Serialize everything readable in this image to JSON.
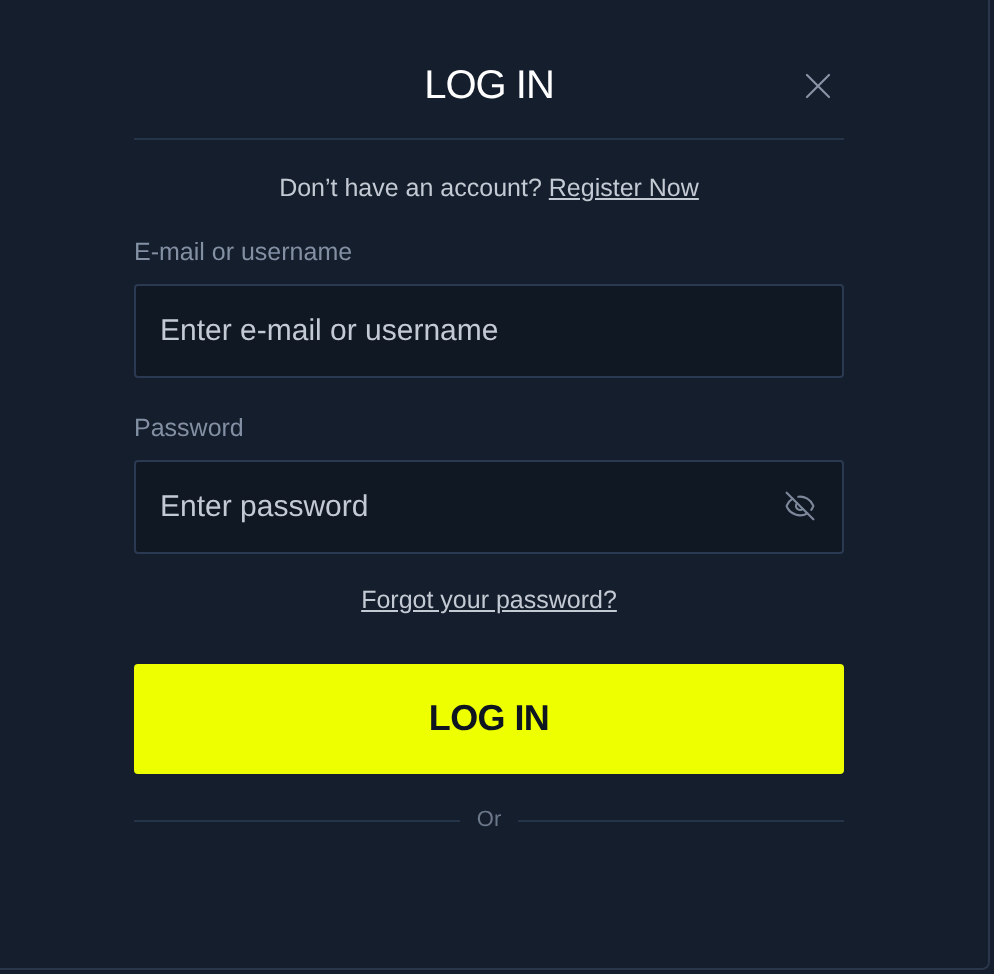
{
  "dialog": {
    "title": "LOG IN"
  },
  "signup_prompt": {
    "text": "Don’t have an account?",
    "link": "Register Now"
  },
  "fields": [
    {
      "label": "E-mail or username",
      "placeholder": "Enter e-mail or username",
      "kind": "text"
    },
    {
      "label": "Password",
      "placeholder": "Enter password",
      "kind": "password"
    }
  ],
  "forgot_link": "Forgot your password?",
  "submit_button": "LOG IN",
  "separator": "Or"
}
